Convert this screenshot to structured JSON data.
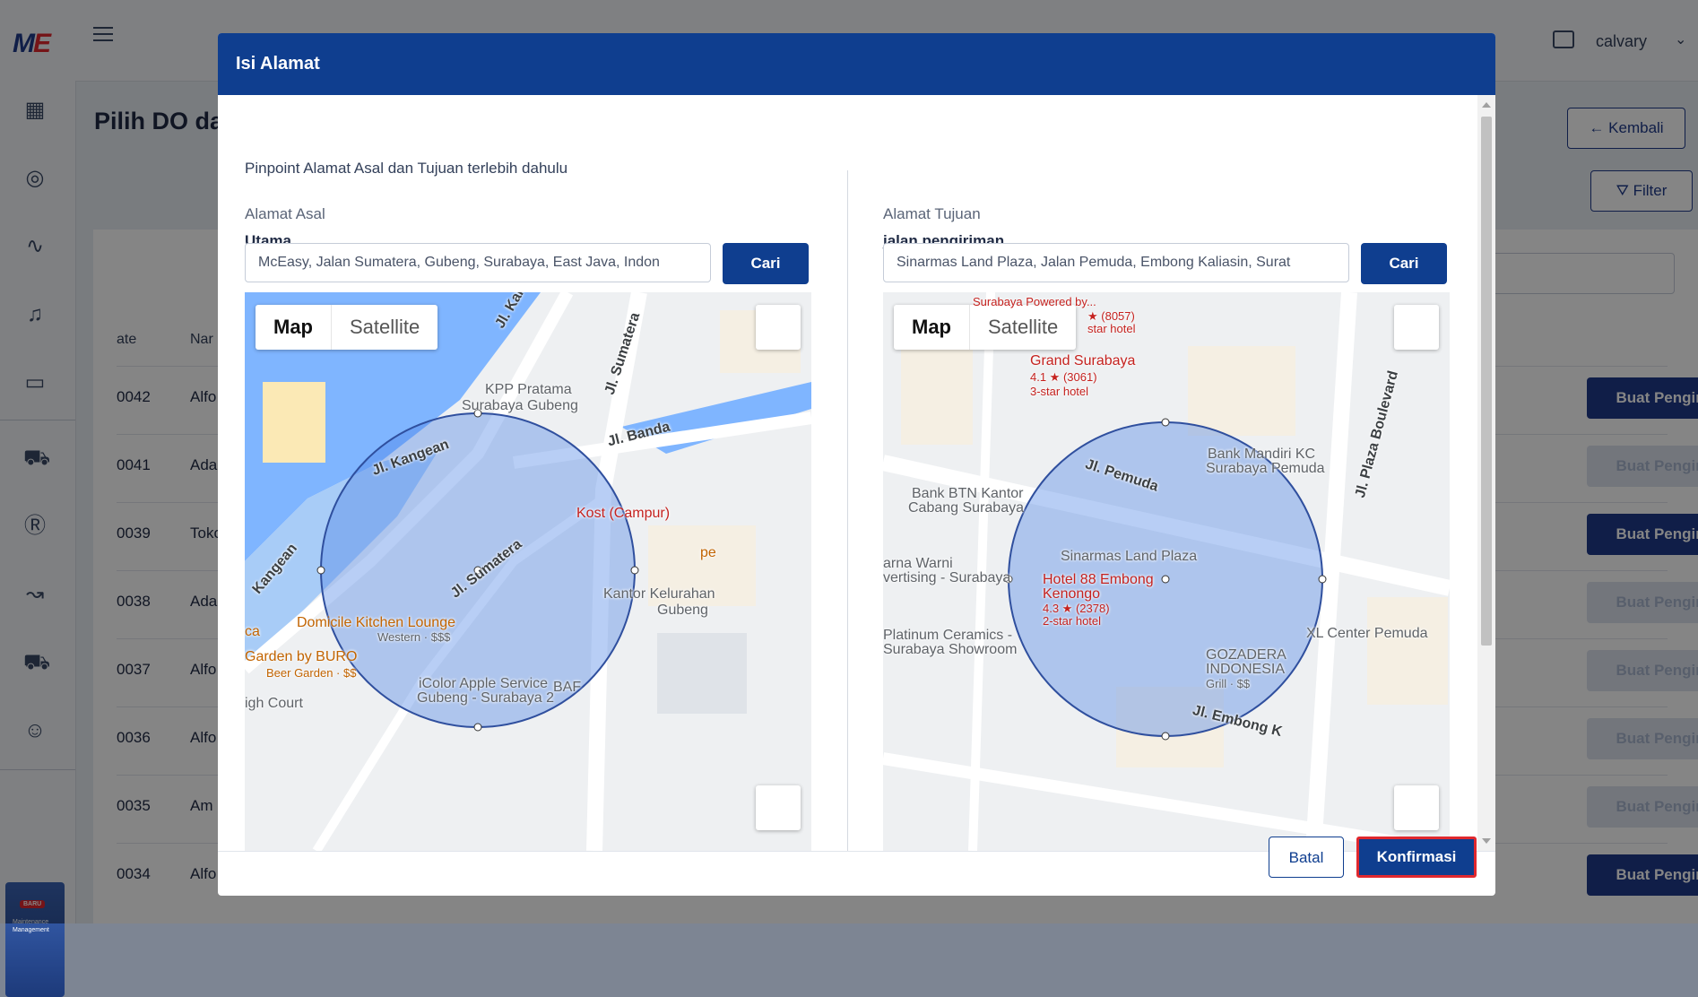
{
  "app": {
    "logo": {
      "m": "M",
      "e": "E"
    },
    "user_name": "calvary",
    "page_title": "Pilih DO da",
    "kembali_label": "Kembali",
    "filter_label": "Filter",
    "promo": {
      "badge": "BARU",
      "text": "Maintenance Management"
    },
    "table": {
      "headers": [
        "ate",
        "Nar"
      ],
      "rows": [
        {
          "id": "0042",
          "name": "Alfo",
          "action": "Buat Pengiriman",
          "enabled": true
        },
        {
          "id": "0041",
          "name": "Ada",
          "action": "Buat Pengiriman",
          "enabled": false
        },
        {
          "id": "0039",
          "name": "Toko",
          "action": "Buat Pengiriman",
          "enabled": true
        },
        {
          "id": "0038",
          "name": "Ada",
          "action": "Buat Pengiriman",
          "enabled": false
        },
        {
          "id": "0037",
          "name": "Alfo",
          "action": "Buat Pengiriman",
          "enabled": false
        },
        {
          "id": "0036",
          "name": "Alfo",
          "action": "Buat Pengiriman",
          "enabled": false
        },
        {
          "id": "0035",
          "name": "Am",
          "action": "Buat Pengiriman",
          "enabled": false
        },
        {
          "id": "0034",
          "name": "Alfo",
          "action": "Buat Pengiriman",
          "enabled": true
        }
      ]
    }
  },
  "modal": {
    "title": "Isi Alamat",
    "instruction": "Pinpoint Alamat Asal dan Tujuan terlebih dahulu",
    "origin": {
      "label": "Alamat Asal",
      "name": "Utama",
      "address": "McEasy, Jalan Sumatera, Gubeng, Surabaya, East Java, Indon",
      "search_label": "Cari",
      "map": {
        "type_map": "Map",
        "type_satellite": "Satellite",
        "labels": {
          "l1": "KPP Pratama",
          "l2": "Surabaya Gubeng",
          "l3": "Jl. Sumatera",
          "l4": "Jl. Kai",
          "l5": "Jl. Banda",
          "l6": "Jl. Kangean",
          "l7": "Kost (Campur)",
          "l8": "pe",
          "l9": "Kangean",
          "l10": "Jl. Sumatera",
          "l11": "Kantor Kelurahan",
          "l12": "Gubeng",
          "l13": "Domicile Kitchen Lounge",
          "l14": "Western · $$$",
          "l15": "ca",
          "l16": "Garden by BURO",
          "l17": "Beer Garden · $$",
          "l18": "iColor Apple Service",
          "l19": "Gubeng - Surabaya 2",
          "l20": "BAF",
          "l21": "igh Court"
        }
      }
    },
    "destination": {
      "label": "Alamat Tujuan",
      "name": "jalan pengiriman",
      "address": "Sinarmas Land Plaza, Jalan Pemuda, Embong Kaliasin, Surat",
      "search_label": "Cari",
      "map": {
        "type_map": "Map",
        "type_satellite": "Satellite",
        "labels": {
          "d1": "Surabaya Powered by...",
          "d2": "★ (8057)",
          "d3": "star hotel",
          "d4": "Grand Surabaya",
          "d5": "4.1 ★ (3061)",
          "d6": "3-star hotel",
          "d7": "Bank Mandiri KC",
          "d8": "Surabaya Pemuda",
          "d9": "Jl. Plaza Boulevard",
          "d10": "Jl. Pemuda",
          "d11": "Bank BTN Kantor",
          "d12": "Cabang Surabaya",
          "d13": "Sinarmas Land Plaza",
          "d14": "arna Warni",
          "d15": "vertising - Surabaya",
          "d16": "Hotel 88 Embong",
          "d17": "Kenongo",
          "d18": "4.3 ★ (2378)",
          "d19": "2-star hotel",
          "d20": "Platinum Ceramics -",
          "d21": "Surabaya Showroom",
          "d22": "XL Center Pemuda",
          "d23": "GOZADERA",
          "d24": "INDONESIA",
          "d25": "Grill · $$",
          "d26": "Jl. Embong K"
        }
      }
    },
    "batal_label": "Batal",
    "konfirmasi_label": "Konfirmasi"
  }
}
